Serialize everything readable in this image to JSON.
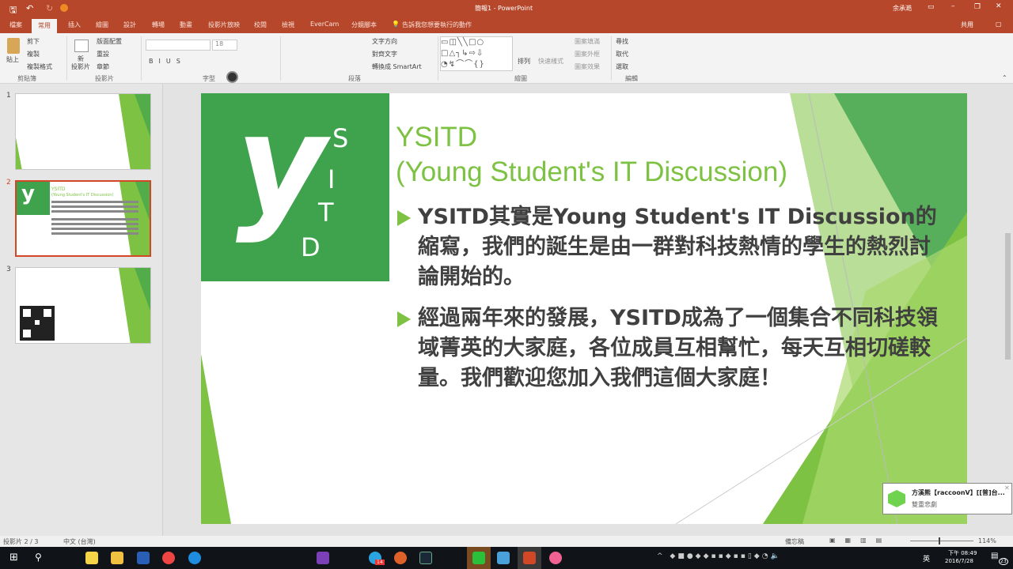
{
  "window": {
    "title": "簡報1 - PowerPoint",
    "user": "余承澔"
  },
  "tabs": [
    "檔案",
    "常用",
    "插入",
    "繪圖",
    "設計",
    "轉場",
    "動畫",
    "投影片放映",
    "校閱",
    "檢視",
    "EverCam",
    "分鏡腳本"
  ],
  "active_tab": "常用",
  "tell_me": "告訴我您想要執行的動作",
  "share": "共用",
  "ribbon": {
    "clipboard": {
      "paste": "貼上",
      "cut": "剪下",
      "copy": "複製",
      "format_painter": "複製格式",
      "label": "剪貼簿"
    },
    "slides": {
      "new_slide": "新\n投影片",
      "layout": "版面配置",
      "reset": "重設",
      "section": "章節",
      "label": "投影片"
    },
    "font": {
      "font_size": "18",
      "label": "字型"
    },
    "paragraph": {
      "text_direction": "文字方向",
      "align_text": "對齊文字",
      "smartart": "轉換成 SmartArt",
      "label": "段落"
    },
    "drawing": {
      "arrange": "排列",
      "quick_styles": "快速樣式",
      "shape_fill": "圖案填滿",
      "shape_outline": "圖案外框",
      "shape_effects": "圖案效果",
      "label": "繪圖"
    },
    "editing": {
      "find": "尋找",
      "replace": "取代",
      "select": "選取",
      "label": "編輯"
    }
  },
  "thumbnails": [
    {
      "num": "1"
    },
    {
      "num": "2",
      "title": "YSITD",
      "subtitle": "(Young Student's IT Discussion)"
    },
    {
      "num": "3"
    }
  ],
  "slide": {
    "logo_letter": "y",
    "logo_letters": [
      "S",
      "I",
      "T",
      "D"
    ],
    "title_line1": "YSITD",
    "title_line2": "(Young Student's IT Discussion)",
    "bullets": [
      "YSITD其實是Young Student's IT Discussion的縮寫，我們的誕生是由一群對科技熱情的學生的熱烈討論開始的。",
      "經過兩年來的發展，YSITD成為了一個集合不同科技領域菁英的大家庭，各位成員互相幫忙，每天互相切磋較量。我們歡迎您加入我們這個大家庭！"
    ]
  },
  "notification": {
    "title": "方溪熊【raccoonV】[[普]台...",
    "body": "雙重悲劇"
  },
  "status": {
    "slide": "投影片 2 / 3",
    "language": "中文 (台灣)",
    "notes": "備忘稿",
    "zoom": "114%"
  },
  "taskbar": {
    "time": "下午 08:49",
    "date": "2016/7/28",
    "ime": "英",
    "notif_count": "23",
    "badge": "14"
  },
  "colors": {
    "accent": "#b7472a",
    "green": "#7dc242",
    "logo_green": "#3fa34d"
  }
}
